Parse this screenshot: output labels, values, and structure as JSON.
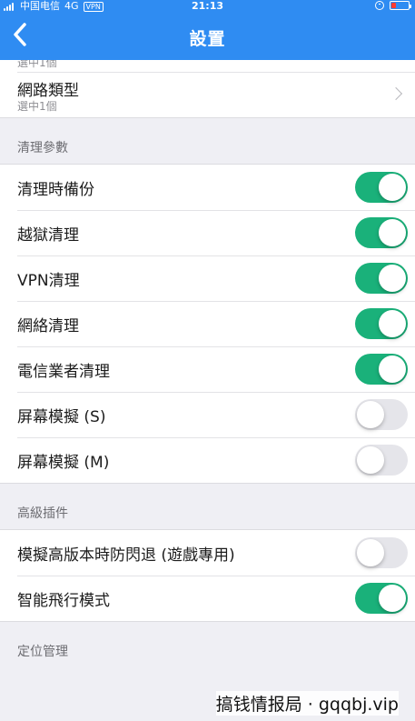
{
  "status_bar": {
    "carrier": "中国电信",
    "network": "4G",
    "vpn": "VPN",
    "time": "21:13"
  },
  "nav": {
    "title": "設置",
    "back_icon": "chevron-left-icon"
  },
  "top_partial": {
    "subtitle": "選中1個"
  },
  "network_type": {
    "label": "網路類型",
    "subtitle": "選中1個"
  },
  "sections": [
    {
      "header": "清理參數",
      "rows": [
        {
          "label": "清理時備份",
          "on": true
        },
        {
          "label": "越獄清理",
          "on": true
        },
        {
          "label": "VPN清理",
          "on": true
        },
        {
          "label": "網絡清理",
          "on": true
        },
        {
          "label": "電信業者清理",
          "on": true
        },
        {
          "label": "屏幕模擬 (S)",
          "on": false
        },
        {
          "label": "屏幕模擬 (M)",
          "on": false
        }
      ]
    },
    {
      "header": "高級插件",
      "rows": [
        {
          "label": "模擬高版本時防閃退 (遊戲專用)",
          "on": false
        },
        {
          "label": "智能飛行模式",
          "on": true
        }
      ]
    },
    {
      "header": "定位管理",
      "rows": []
    }
  ],
  "watermark": "搞钱情报局 · gqqbj.vip",
  "colors": {
    "nav_bg": "#2f8cf2",
    "switch_on": "#1ab17a",
    "switch_off": "#e5e5ea",
    "page_bg": "#efeff4"
  }
}
